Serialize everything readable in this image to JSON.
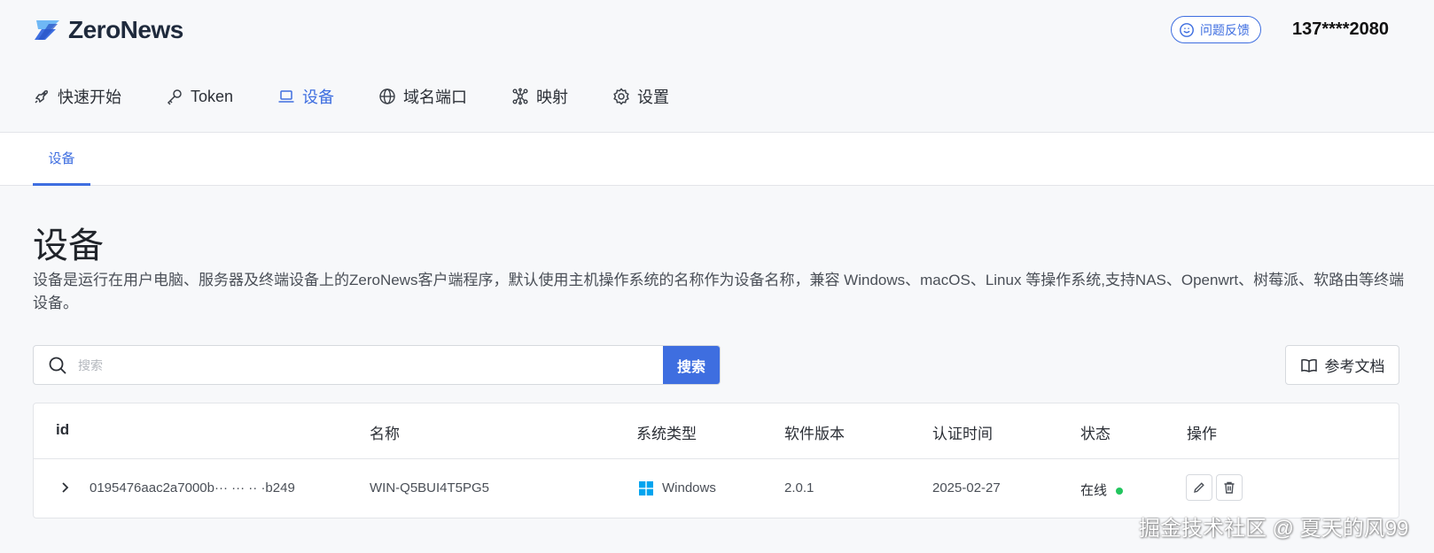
{
  "header": {
    "logo_text": "ZeroNews",
    "feedback_label": "问题反馈",
    "user_phone": "137****2080"
  },
  "nav": {
    "items": [
      {
        "label": "快速开始",
        "icon": "rocket-icon"
      },
      {
        "label": "Token",
        "icon": "key-icon"
      },
      {
        "label": "设备",
        "icon": "laptop-icon",
        "active": true
      },
      {
        "label": "域名端口",
        "icon": "globe-icon"
      },
      {
        "label": "映射",
        "icon": "network-icon"
      },
      {
        "label": "设置",
        "icon": "gear-icon"
      }
    ]
  },
  "subtabs": [
    {
      "label": "设备",
      "active": true
    }
  ],
  "main": {
    "title": "设备",
    "description": "设备是运行在用户电脑、服务器及终端设备上的ZeroNews客户端程序，默认使用主机操作系统的名称作为设备名称，兼容 Windows、macOS、Linux 等操作系统,支持NAS、Openwrt、树莓派、软路由等终端设备。",
    "search": {
      "placeholder": "搜索",
      "value": "",
      "button_label": "搜索"
    },
    "doc_button_label": "参考文档"
  },
  "table": {
    "columns": [
      "id",
      "名称",
      "系统类型",
      "软件版本",
      "认证时间",
      "状态",
      "操作"
    ],
    "rows": [
      {
        "id": "0195476aac2a7000b··· ··· ·· ·b249",
        "name": "WIN-Q5BUI4T5PG5",
        "os": "Windows",
        "version": "2.0.1",
        "auth_time": "2025-02-27",
        "status": "在线"
      }
    ]
  },
  "colors": {
    "accent": "#3e6ee0",
    "online": "#22c55e",
    "windows": "#00a4ef"
  },
  "watermark": "掘金技术社区 @ 夏天的风99"
}
